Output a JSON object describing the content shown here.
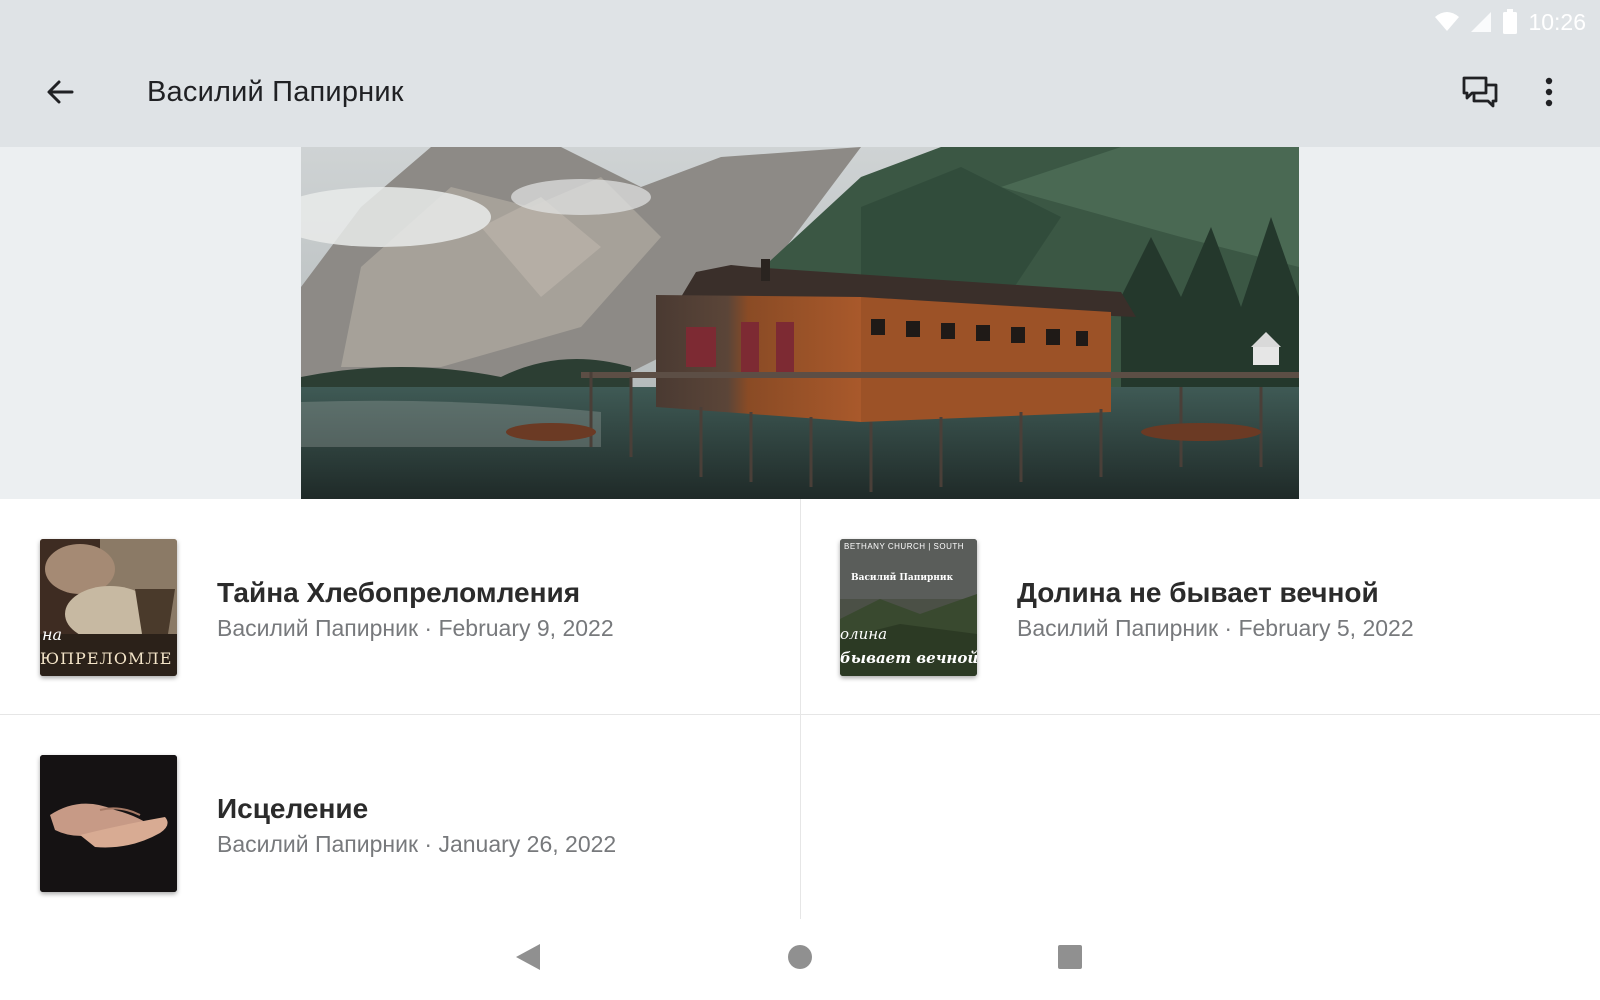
{
  "status_bar": {
    "time": "10:26",
    "icons": [
      "wifi-icon",
      "signal-icon",
      "battery-icon"
    ]
  },
  "app_bar": {
    "title": "Василий Папирник",
    "back_icon": "arrow-back-icon",
    "actions": [
      "chat-icon",
      "more-vert-icon"
    ]
  },
  "banner": {
    "image": "mountain lake boathouse photo"
  },
  "sermons": [
    {
      "title": "Тайна Хлебопреломления",
      "author": "Василий Папирник",
      "date": "February 9, 2022",
      "meta": "Василий Папирник · February 9, 2022",
      "thumb_caption_top": "на",
      "thumb_caption_bottom": "ЮПРЕЛОМЛЕ"
    },
    {
      "title": "Долина не бывает вечной",
      "author": "Василий Папирник",
      "date": "February 5, 2022",
      "meta": "Василий Папирник · February 5, 2022",
      "thumb_header": "BETHANY CHURCH | SOUTH",
      "thumb_author": "Василий Папирник",
      "thumb_caption_top": "олина",
      "thumb_caption_bottom": "бывает вечной"
    },
    {
      "title": "Исцеление",
      "author": "Василий Папирник",
      "date": "January 26, 2022",
      "meta": "Василий Папирник · January 26, 2022"
    }
  ],
  "nav_bar": {
    "buttons": [
      "nav-back-icon",
      "nav-home-icon",
      "nav-recents-icon"
    ]
  },
  "colors": {
    "app_bar_bg": "#dfe3e6",
    "title_text": "#202124",
    "meta_text": "#77797c",
    "nav_icon": "#909090"
  }
}
